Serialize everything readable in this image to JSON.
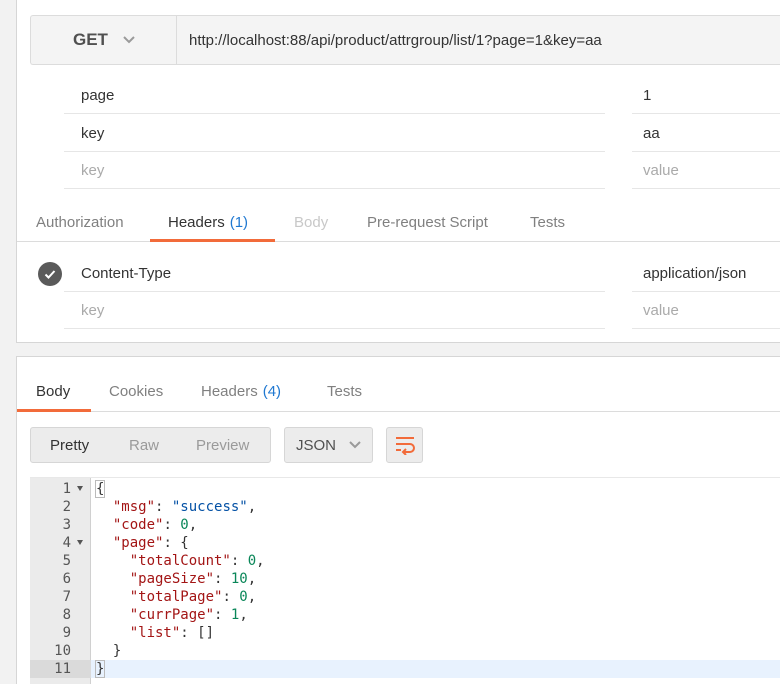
{
  "request": {
    "method": "GET",
    "url": "http://localhost:88/api/product/attrgroup/list/1?page=1&key=aa",
    "params": [
      {
        "key": "page",
        "value": "1"
      },
      {
        "key": "key",
        "value": "aa"
      }
    ],
    "param_placeholder": {
      "key": "key",
      "value": "value"
    },
    "tabs": {
      "authorization": "Authorization",
      "headers": "Headers",
      "headers_count": "(1)",
      "body": "Body",
      "prerequest": "Pre-request Script",
      "tests": "Tests"
    },
    "headers": [
      {
        "key": "Content-Type",
        "value": "application/json"
      }
    ],
    "header_placeholder": {
      "key": "key",
      "value": "value"
    }
  },
  "response": {
    "tabs": {
      "body": "Body",
      "cookies": "Cookies",
      "headers": "Headers",
      "headers_count": "(4)",
      "tests": "Tests"
    },
    "view_modes": [
      "Pretty",
      "Raw",
      "Preview"
    ],
    "active_view": "Pretty",
    "format": "JSON",
    "lines": [
      {
        "n": "1",
        "text": "{"
      },
      {
        "n": "2",
        "key": "\"msg\"",
        "val": "\"success\"",
        "type": "s"
      },
      {
        "n": "3",
        "key": "\"code\"",
        "val": "0",
        "type": "n"
      },
      {
        "n": "4",
        "key": "\"page\"",
        "val": "{",
        "type": "p"
      },
      {
        "n": "5",
        "key": "\"totalCount\"",
        "val": "0",
        "type": "n"
      },
      {
        "n": "6",
        "key": "\"pageSize\"",
        "val": "10",
        "type": "n"
      },
      {
        "n": "7",
        "key": "\"totalPage\"",
        "val": "0",
        "type": "n"
      },
      {
        "n": "8",
        "key": "\"currPage\"",
        "val": "1",
        "type": "n"
      },
      {
        "n": "9",
        "key": "\"list\"",
        "val": "[]",
        "type": "p"
      },
      {
        "n": "10",
        "text": "}"
      },
      {
        "n": "11",
        "text": "}"
      }
    ]
  },
  "colors": {
    "accent": "#f26b3a",
    "count": "#1f78d1"
  },
  "icons": [
    "chevron-down-icon",
    "check-circle-icon",
    "wrap-lines-icon",
    "fold-arrow-icon"
  ]
}
